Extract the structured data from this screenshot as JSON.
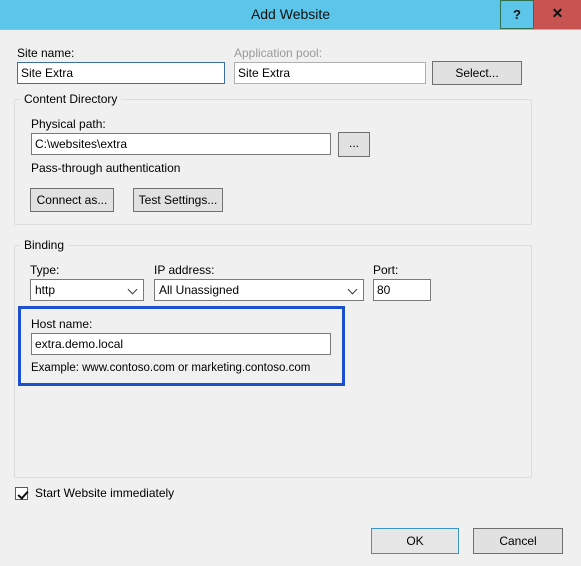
{
  "window": {
    "title": "Add Website",
    "titlebar_color": "#5bc5ea",
    "help_button": "?",
    "close_button": "✕"
  },
  "top_row": {
    "site_name_label": "Site name:",
    "site_name_value": "Site Extra",
    "app_pool_label": "Application pool:",
    "app_pool_value": "Site Extra",
    "select_button": "Select..."
  },
  "content_directory": {
    "group_title": "Content Directory",
    "physical_path_label": "Physical path:",
    "physical_path_value": "C:\\websites\\extra",
    "browse_button": "...",
    "pass_through_label": "Pass-through authentication",
    "connect_as_button": "Connect as...",
    "test_settings_button": "Test Settings..."
  },
  "binding": {
    "group_title": "Binding",
    "type_label": "Type:",
    "type_value": "http",
    "ip_label": "IP address:",
    "ip_value": "All Unassigned",
    "port_label": "Port:",
    "port_value": "80",
    "host_name_label": "Host name:",
    "host_name_value": "extra.demo.local",
    "example_text": "Example: www.contoso.com or marketing.contoso.com",
    "highlight_color": "#1b4fcd"
  },
  "footer": {
    "start_website_label": "Start Website immediately",
    "start_website_checked": true,
    "ok_button": "OK",
    "cancel_button": "Cancel"
  }
}
